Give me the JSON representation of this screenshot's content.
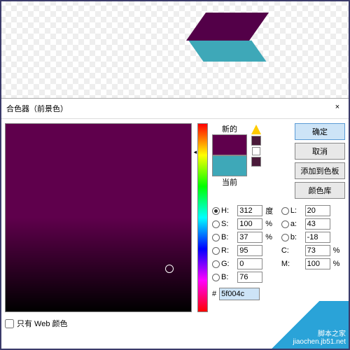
{
  "dialog": {
    "title": "合色器（前景色）",
    "close": "×",
    "webOnly": "只有 Web 颜色",
    "new_label": "新的",
    "current_label": "当前",
    "hex_prefix": "#",
    "hex_value": "5f004c"
  },
  "swatch": {
    "new_color": "#5f004c",
    "current_color": "#3ea8b8",
    "mini_color": "#4a1a3a"
  },
  "buttons": {
    "ok": "确定",
    "cancel": "取消",
    "addSwatch": "添加到色板",
    "libraries": "颜色库"
  },
  "fields": {
    "H": {
      "label": "H:",
      "value": "312",
      "unit": "度"
    },
    "S": {
      "label": "S:",
      "value": "100",
      "unit": "%"
    },
    "Bv": {
      "label": "B:",
      "value": "37",
      "unit": "%"
    },
    "L": {
      "label": "L:",
      "value": "20",
      "unit": ""
    },
    "a": {
      "label": "a:",
      "value": "43",
      "unit": ""
    },
    "b": {
      "label": "b:",
      "value": "-18",
      "unit": ""
    },
    "R": {
      "label": "R:",
      "value": "95",
      "unit": ""
    },
    "G": {
      "label": "G:",
      "value": "0",
      "unit": ""
    },
    "Bc": {
      "label": "B:",
      "value": "76",
      "unit": ""
    },
    "C": {
      "label": "C:",
      "value": "73",
      "unit": "%"
    },
    "M": {
      "label": "M:",
      "value": "100",
      "unit": "%"
    }
  },
  "watermark": "脚本之家 jiaochen.jb51.net"
}
